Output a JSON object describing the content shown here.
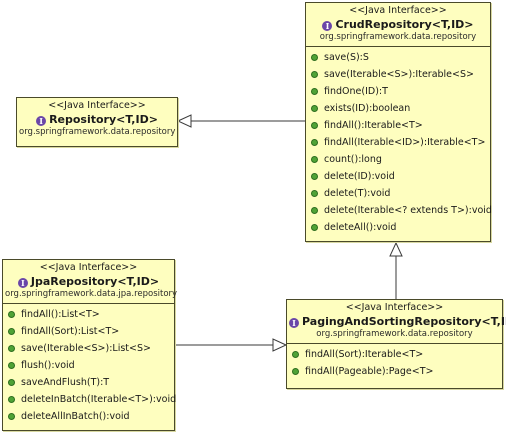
{
  "interfaces": {
    "crud": {
      "stereotype": "<<Java Interface>>",
      "name": "CrudRepository<T,ID>",
      "package": "org.springframework.data.repository",
      "methods": [
        "save(S):S",
        "save(Iterable<S>):Iterable<S>",
        "findOne(ID):T",
        "exists(ID):boolean",
        "findAll():Iterable<T>",
        "findAll(Iterable<ID>):Iterable<T>",
        "count():long",
        "delete(ID):void",
        "delete(T):void",
        "delete(Iterable<? extends T>):void",
        "deleteAll():void"
      ]
    },
    "repository": {
      "stereotype": "<<Java Interface>>",
      "name": "Repository<T,ID>",
      "package": "org.springframework.data.repository"
    },
    "jpa": {
      "stereotype": "<<Java Interface>>",
      "name": "JpaRepository<T,ID>",
      "package": "org.springframework.data.jpa.repository",
      "methods": [
        "findAll():List<T>",
        "findAll(Sort):List<T>",
        "save(Iterable<S>):List<S>",
        "flush():void",
        "saveAndFlush(T):T",
        "deleteInBatch(Iterable<T>):void",
        "deleteAllInBatch():void"
      ]
    },
    "paging": {
      "stereotype": "<<Java Interface>>",
      "name": "PagingAndSortingRepository<T,ID>",
      "package": "org.springframework.data.repository",
      "methods": [
        "findAll(Sort):Iterable<T>",
        "findAll(Pageable):Page<T>"
      ]
    }
  },
  "icons": {
    "interface_badge": "I",
    "interface_icon": "interface-icon",
    "method_icon": "public-method-icon"
  },
  "colors": {
    "box_fill": "#fefebf",
    "border": "#4a4a2a",
    "method_dot": "#4fa336",
    "interface_badge": "#6a46a8"
  },
  "relations": [
    {
      "from": "CrudRepository<T,ID>",
      "to": "Repository<T,ID>",
      "type": "generalization"
    },
    {
      "from": "PagingAndSortingRepository<T,ID>",
      "to": "CrudRepository<T,ID>",
      "type": "generalization"
    },
    {
      "from": "JpaRepository<T,ID>",
      "to": "PagingAndSortingRepository<T,ID>",
      "type": "generalization"
    }
  ]
}
